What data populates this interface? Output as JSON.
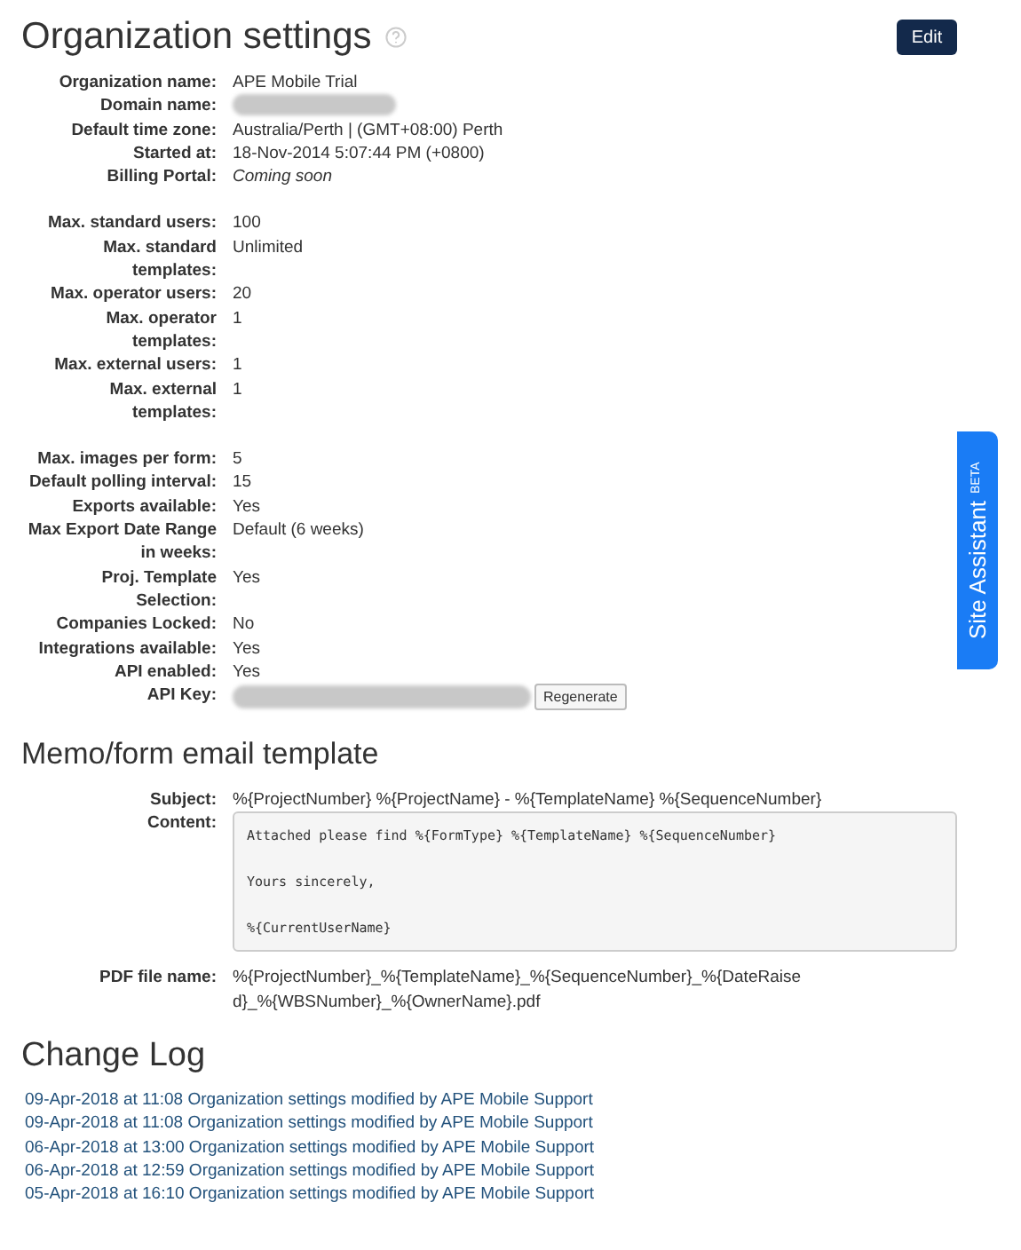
{
  "title": "Organization settings",
  "edit_button": "Edit",
  "settings_groups": [
    [
      {
        "label": "Organization name:",
        "kind": "text",
        "value": "APE Mobile Trial"
      },
      {
        "label": "Domain name:",
        "kind": "redacted"
      },
      {
        "label": "Default time zone:",
        "kind": "text",
        "value": "Australia/Perth | (GMT+08:00) Perth"
      },
      {
        "label": "Started at:",
        "kind": "text",
        "value": "18-Nov-2014 5:07:44 PM (+0800)"
      },
      {
        "label": "Billing Portal:",
        "kind": "italic",
        "value": "Coming soon"
      }
    ],
    [
      {
        "label": "Max. standard users:",
        "kind": "text",
        "value": "100"
      },
      {
        "label": "Max. standard templates:",
        "kind": "text",
        "value": "Unlimited"
      },
      {
        "label": "Max. operator users:",
        "kind": "text",
        "value": "20"
      },
      {
        "label": "Max. operator templates:",
        "kind": "text",
        "value": "1"
      },
      {
        "label": "Max. external users:",
        "kind": "text",
        "value": "1"
      },
      {
        "label": "Max. external templates:",
        "kind": "text",
        "value": "1"
      }
    ],
    [
      {
        "label": "Max. images per form:",
        "kind": "text",
        "value": "5"
      },
      {
        "label": "Default polling interval:",
        "kind": "text",
        "value": "15"
      },
      {
        "label": "Exports available:",
        "kind": "text",
        "value": "Yes"
      },
      {
        "label": "Max Export Date Range in weeks:",
        "kind": "text",
        "value": "Default (6 weeks)"
      },
      {
        "label": "Proj. Template Selection:",
        "kind": "text",
        "value": "Yes"
      },
      {
        "label": "Companies Locked:",
        "kind": "text",
        "value": "No"
      },
      {
        "label": "Integrations available:",
        "kind": "text",
        "value": "Yes"
      },
      {
        "label": "API enabled:",
        "kind": "text",
        "value": "Yes"
      },
      {
        "label": "API Key:",
        "kind": "redacted_with_button",
        "button": "Regenerate"
      }
    ]
  ],
  "email_template": {
    "heading": "Memo/form email template",
    "subject_label": "Subject:",
    "subject": "%{ProjectNumber} %{ProjectName} - %{TemplateName} %{SequenceNumber}",
    "content_label": "Content:",
    "content_lines": [
      "Attached please find %{FormType} %{TemplateName} %{SequenceNumber}",
      "Yours sincerely,",
      "%{CurrentUserName}"
    ],
    "pdf_label": "PDF file name:",
    "pdf_name": "%{ProjectNumber}_%{TemplateName}_%{SequenceNumber}_%{DateRaised}_%{WBSNumber}_%{OwnerName}.pdf"
  },
  "change_log": {
    "heading": "Change Log",
    "entries": [
      "09-Apr-2018 at 11:08 Organization settings modified by APE Mobile Support",
      "09-Apr-2018 at 11:08 Organization settings modified by APE Mobile Support",
      "06-Apr-2018 at 13:00 Organization settings modified by APE Mobile Support",
      "06-Apr-2018 at 12:59 Organization settings modified by APE Mobile Support",
      "05-Apr-2018 at 16:10 Organization settings modified by APE Mobile Support"
    ]
  },
  "site_assistant": {
    "label": "Site Assistant",
    "badge": "BETA"
  }
}
